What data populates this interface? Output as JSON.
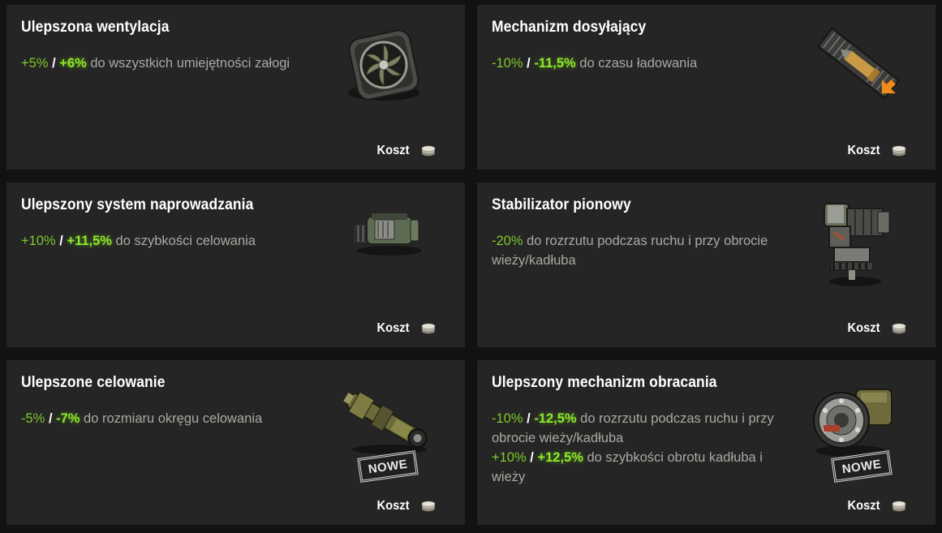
{
  "cost_label": "Koszt",
  "nowe_label": "NOWE",
  "cards": [
    {
      "title": "Ulepszona wentylacja",
      "icon": "ventilation-fan-icon",
      "lines": [
        {
          "v1": "+5%",
          "sep": "/",
          "v2": "+6%",
          "text": " do wszystkich umiejętności załogi"
        }
      ]
    },
    {
      "title": "Mechanizm dosyłający",
      "icon": "rammer-shell-icon",
      "lines": [
        {
          "v1": "-10%",
          "sep": "/",
          "v2": "-11,5%",
          "text": " do czasu ładowania"
        }
      ]
    },
    {
      "title": "Ulepszony system naprowadzania",
      "icon": "gun-laying-drive-icon",
      "lines": [
        {
          "v1": "+10%",
          "sep": "/",
          "v2": "+11,5%",
          "text": " do szybkości celowania"
        }
      ]
    },
    {
      "title": "Stabilizator pionowy",
      "icon": "vertical-stabilizer-icon",
      "lines": [
        {
          "v1": "-20%",
          "text": " do rozrzutu podczas ruchu i przy obrocie",
          "cont": "wieży/kadłuba"
        }
      ]
    },
    {
      "title": "Ulepszone celowanie",
      "icon": "aiming-device-icon",
      "is_new": true,
      "lines": [
        {
          "v1": "-5%",
          "sep": "/",
          "v2": "-7%",
          "text": " do rozmiaru okręgu celowania"
        }
      ]
    },
    {
      "title": "Ulepszony mechanizm obracania",
      "icon": "turret-traverse-icon",
      "is_new": true,
      "lines": [
        {
          "v1": "-10%",
          "sep": "/",
          "v2": "-12,5%",
          "text": " do rozrzutu podczas ruchu i przy",
          "cont": "obrocie wieży/kadłuba"
        },
        {
          "v1": "+10%",
          "sep": "/",
          "v2": "+12,5%",
          "text": " do szybkości obrotu kadłuba i",
          "cont": "wieży"
        }
      ]
    }
  ]
}
